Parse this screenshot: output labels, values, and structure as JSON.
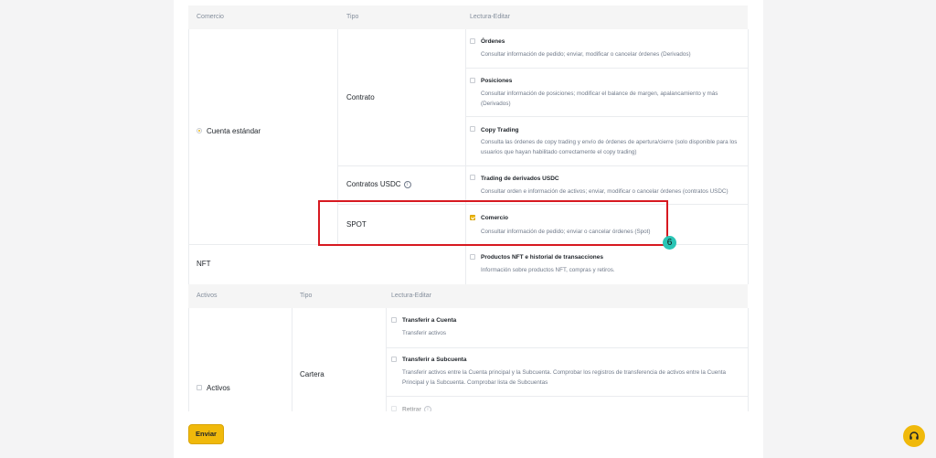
{
  "table1": {
    "headers": {
      "col1": "Comercio",
      "col2": "Tipo",
      "col3": "Lectura-Editar"
    },
    "account_label": "Cuenta estándar",
    "contrato_label": "Contrato",
    "usdc_label": "Contratos USDC",
    "spot_label": "SPOT",
    "nft_label": "NFT",
    "permissions": [
      {
        "title": "Órdenes",
        "desc": "Consultar información de pedido; enviar, modificar o cancelar órdenes (Derivados)",
        "checked": false
      },
      {
        "title": "Posiciones",
        "desc": "Consultar información de posiciones; modificar el balance de margen, apalancamiento y más (Derivados)",
        "checked": false
      },
      {
        "title": "Copy Trading",
        "desc": "Consulta las órdenes de copy trading y envío de órdenes de apertura/cierre (solo disponible para los usuarios que hayan habilitado correctamente el copy trading)",
        "checked": false
      },
      {
        "title": "Trading de derivados USDC",
        "desc": "Consultar orden e información de activos; enviar, modificar o cancelar órdenes (contratos USDC)",
        "checked": false
      },
      {
        "title": "Comercio",
        "desc": "Consultar información de pedido; enviar o cancelar órdenes (Spot)",
        "checked": true
      },
      {
        "title": "Productos NFT e historial de transacciones",
        "desc": "Información sobre productos NFT, compras y retiros.",
        "checked": false
      }
    ]
  },
  "table2": {
    "headers": {
      "col1": "Activos",
      "col2": "Tipo",
      "col3": "Lectura-Editar"
    },
    "assets_label": "Activos",
    "cartera_label": "Cartera",
    "permissions": [
      {
        "title": "Transferir a Cuenta",
        "desc": "Transferir activos"
      },
      {
        "title": "Transferir a Subcuenta",
        "desc": "Transferir activos entre la Cuenta principal y la Subcuenta. Comprobar los registros de transferencia de activos entre la Cuenta Principal y la Subcuenta. Comprobar lista de Subcuentas"
      },
      {
        "title": "Retirar",
        "desc": ""
      }
    ]
  },
  "step_badge": "6",
  "submit_label": "Enviar",
  "colors": {
    "accent": "#f0b90b",
    "highlight": "#d71920",
    "badge": "#2ac5b5"
  },
  "icons": {
    "support": "headset-icon",
    "info": "info-icon"
  }
}
